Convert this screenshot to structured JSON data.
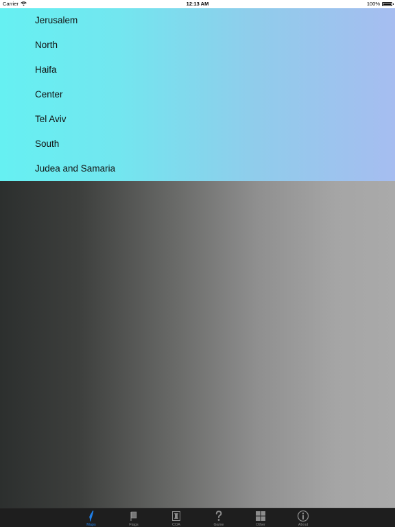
{
  "status_bar": {
    "carrier": "Carrier",
    "time": "12:13 AM",
    "battery": "100%",
    "battery_level": 1.0
  },
  "regions": [
    {
      "label": "Jerusalem"
    },
    {
      "label": "North"
    },
    {
      "label": "Haifa"
    },
    {
      "label": "Center"
    },
    {
      "label": "Tel Aviv"
    },
    {
      "label": "South"
    },
    {
      "label": "Judea and Samaria"
    }
  ],
  "tab_bar": {
    "active_color": "#1f7ee6",
    "inactive_color": "#8c8c8c",
    "tabs": [
      {
        "label": "Maps",
        "icon": "israel-map-icon",
        "active": true
      },
      {
        "label": "Flags",
        "icon": "flag-icon",
        "active": false
      },
      {
        "label": "COA",
        "icon": "emblem-icon",
        "active": false
      },
      {
        "label": "Game",
        "icon": "question-mark-icon",
        "active": false
      },
      {
        "label": "Other",
        "icon": "grid-icon",
        "active": false
      },
      {
        "label": "About",
        "icon": "info-icon",
        "active": false
      }
    ]
  }
}
